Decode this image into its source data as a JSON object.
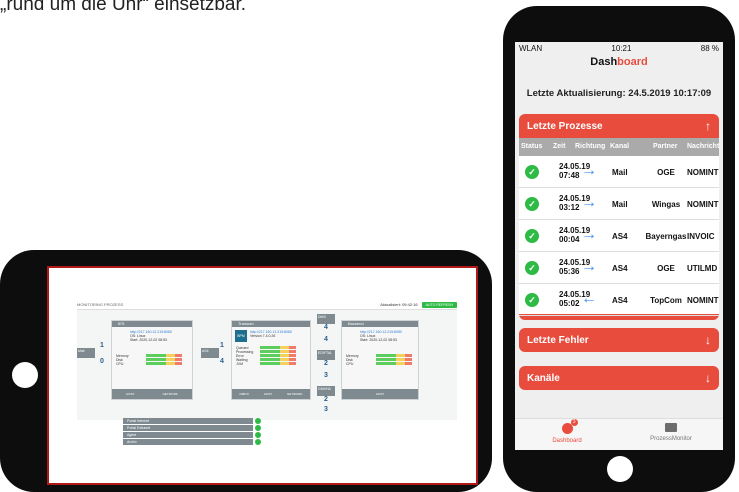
{
  "caption": "„rund um die Uhr“ einsetzbar.",
  "tablet": {
    "title": "MONITORING PROZESS",
    "aktualisiert": "Aktualisiert: 09:42:16",
    "auto_refresh": "AUTO REFRESH",
    "left_box": "Mail",
    "left_num_top": "1",
    "left_num_bottom": "0",
    "mid_left_box": "AS4",
    "mid_left_num_top": "1",
    "mid_left_num_bottom": "4",
    "node1": {
      "title": "IES",
      "url": "http://217.160.12.219:8080",
      "os": "OS: Linux",
      "start": "Start: 2020-12-02 08:53",
      "labels": [
        "Memory",
        "Disk",
        "CPU"
      ],
      "foot": [
        "HOST",
        "NETWORK"
      ]
    },
    "node2": {
      "title": "Transum",
      "url": "http://217.160.13.219:8080",
      "ver": "Version 7.4.0.26",
      "labels": [
        "Queued",
        "Processing",
        "Error",
        "Waiting",
        "JVM"
      ],
      "foot": [
        "INBOX",
        "HOST",
        "NETWORK"
      ],
      "tag": "BPM"
    },
    "node3": {
      "title": "Backend",
      "url": "http://217.160.12.219:8080",
      "os": "OS: Linux",
      "start": "Start: 2020-12-02 08:53",
      "labels": [
        "Memory",
        "Disk",
        "CPU"
      ],
      "foot": [
        "HOST"
      ]
    },
    "right_boxes": [
      {
        "label": "DMS",
        "top": "4",
        "bottom": "4"
      },
      {
        "label": "EDIFTAL",
        "top": "2",
        "bottom": "3"
      },
      {
        "label": "GMXHA",
        "top": "2",
        "bottom": "3"
      }
    ],
    "process_rows": [
      "Portal Internet",
      "Portal Extranet",
      "Agent",
      "Archiv"
    ]
  },
  "phone": {
    "status_left": "WLAN",
    "status_time": "10:21",
    "status_right": "88 %",
    "title_a": "Dash",
    "title_b": "board",
    "last_update": "Letzte Aktualisierung: 24.5.2019 10:17:09",
    "card_prozesse": {
      "title": "Letzte Prozesse",
      "icon": "↑"
    },
    "columns": [
      "Status",
      "Zeit",
      "Richtung",
      "Kanal",
      "Partner",
      "Nachricht"
    ],
    "rows": [
      {
        "date": "24.05.19",
        "time": "07:48",
        "dir": "→",
        "kanal": "Mail",
        "partner": "OGE",
        "nachricht": "NOMINT"
      },
      {
        "date": "24.05.19",
        "time": "03:12",
        "dir": "→",
        "kanal": "Mail",
        "partner": "Wingas",
        "nachricht": "NOMINT"
      },
      {
        "date": "24.05.19",
        "time": "00:04",
        "dir": "→",
        "kanal": "AS4",
        "partner": "Bayerngas",
        "nachricht": "INVOIC"
      },
      {
        "date": "24.05.19",
        "time": "05:36",
        "dir": "→",
        "kanal": "AS4",
        "partner": "OGE",
        "nachricht": "UTILMD"
      },
      {
        "date": "24.05.19",
        "time": "05:02",
        "dir": "←",
        "kanal": "AS4",
        "partner": "TopCom",
        "nachricht": "NOMINT"
      }
    ],
    "card_fehler": {
      "title": "Letzte Fehler",
      "icon": "↓"
    },
    "card_kanaele": {
      "title": "Kanäle",
      "icon": "↓"
    },
    "tabs": [
      {
        "label": "Dashboard",
        "badge": "3"
      },
      {
        "label": "ProzessMonitor"
      }
    ]
  },
  "colors": {
    "accent": "#e84c3d",
    "ok": "#2dbb45",
    "arrow": "#3f8ff0"
  }
}
